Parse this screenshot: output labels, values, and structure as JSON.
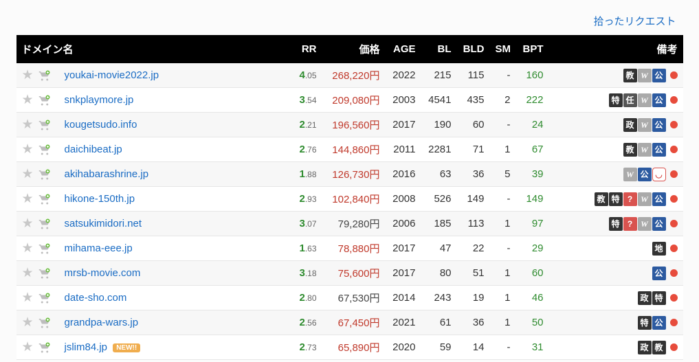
{
  "top_link": "拾ったリクエスト",
  "headers": {
    "domain": "ドメイン名",
    "rr": "RR",
    "price": "価格",
    "age": "AGE",
    "bl": "BL",
    "bld": "BLD",
    "sm": "SM",
    "bpt": "BPT",
    "notes": "備考"
  },
  "new_label": "NEW!!",
  "tag_glyphs": {
    "edu": "教",
    "w": "W",
    "pub": "公",
    "sp": "特",
    "ap": "任",
    "q": "?",
    "lo": "地",
    "gov": "政",
    "poc": "◡"
  },
  "rows": [
    {
      "domain": "youkai-movie2022.jp",
      "rr_i": "4",
      "rr_d": ".05",
      "price": "268,220円",
      "price_red": true,
      "age": "2022",
      "bl": "215",
      "bld": "115",
      "sm": "-",
      "bpt": "160",
      "tags": [
        "edu",
        "w",
        "pub"
      ],
      "dot": true
    },
    {
      "domain": "snkplaymore.jp",
      "rr_i": "3",
      "rr_d": ".54",
      "price": "209,080円",
      "price_red": true,
      "age": "2003",
      "bl": "4541",
      "bld": "435",
      "sm": "2",
      "bpt": "222",
      "tags": [
        "sp",
        "ap",
        "w",
        "pub"
      ],
      "dot": true
    },
    {
      "domain": "kougetsudo.info",
      "rr_i": "2",
      "rr_d": ".21",
      "price": "196,560円",
      "price_red": true,
      "age": "2017",
      "bl": "190",
      "bld": "60",
      "sm": "-",
      "bpt": "24",
      "tags": [
        "gov",
        "w",
        "pub"
      ],
      "dot": true
    },
    {
      "domain": "daichibeat.jp",
      "rr_i": "2",
      "rr_d": ".76",
      "price": "144,860円",
      "price_red": true,
      "age": "2011",
      "bl": "2281",
      "bld": "71",
      "sm": "1",
      "bpt": "67",
      "tags": [
        "edu",
        "w",
        "pub"
      ],
      "dot": true
    },
    {
      "domain": "akihabarashrine.jp",
      "rr_i": "1",
      "rr_d": ".88",
      "price": "126,730円",
      "price_red": true,
      "age": "2016",
      "bl": "63",
      "bld": "36",
      "sm": "5",
      "bpt": "39",
      "tags": [
        "w",
        "pub",
        "poc"
      ],
      "dot": true
    },
    {
      "domain": "hikone-150th.jp",
      "rr_i": "2",
      "rr_d": ".93",
      "price": "102,840円",
      "price_red": true,
      "age": "2008",
      "bl": "526",
      "bld": "149",
      "sm": "-",
      "bpt": "149",
      "tags": [
        "edu",
        "sp",
        "q",
        "w",
        "pub"
      ],
      "dot": true
    },
    {
      "domain": "satsukimidori.net",
      "rr_i": "3",
      "rr_d": ".07",
      "price": "79,280円",
      "price_red": false,
      "age": "2006",
      "bl": "185",
      "bld": "113",
      "sm": "1",
      "bpt": "97",
      "tags": [
        "sp",
        "q",
        "w",
        "pub"
      ],
      "dot": true
    },
    {
      "domain": "mihama-eee.jp",
      "rr_i": "1",
      "rr_d": ".63",
      "price": "78,880円",
      "price_red": true,
      "age": "2017",
      "bl": "47",
      "bld": "22",
      "sm": "-",
      "bpt": "29",
      "tags": [
        "lo"
      ],
      "dot": true
    },
    {
      "domain": "mrsb-movie.com",
      "rr_i": "3",
      "rr_d": ".18",
      "price": "75,600円",
      "price_red": true,
      "age": "2017",
      "bl": "80",
      "bld": "51",
      "sm": "1",
      "bpt": "60",
      "tags": [
        "pub"
      ],
      "dot": true
    },
    {
      "domain": "date-sho.com",
      "rr_i": "2",
      "rr_d": ".80",
      "price": "67,530円",
      "price_red": false,
      "age": "2014",
      "bl": "243",
      "bld": "19",
      "sm": "1",
      "bpt": "46",
      "tags": [
        "gov",
        "sp"
      ],
      "dot": true
    },
    {
      "domain": "grandpa-wars.jp",
      "rr_i": "2",
      "rr_d": ".56",
      "price": "67,450円",
      "price_red": true,
      "age": "2021",
      "bl": "61",
      "bld": "36",
      "sm": "1",
      "bpt": "50",
      "tags": [
        "sp",
        "pub"
      ],
      "dot": true
    },
    {
      "domain": "jslim84.jp",
      "new": true,
      "rr_i": "2",
      "rr_d": ".73",
      "price": "65,890円",
      "price_red": true,
      "age": "2020",
      "bl": "59",
      "bld": "14",
      "sm": "-",
      "bpt": "31",
      "tags": [
        "gov",
        "edu"
      ],
      "dot": true
    }
  ]
}
